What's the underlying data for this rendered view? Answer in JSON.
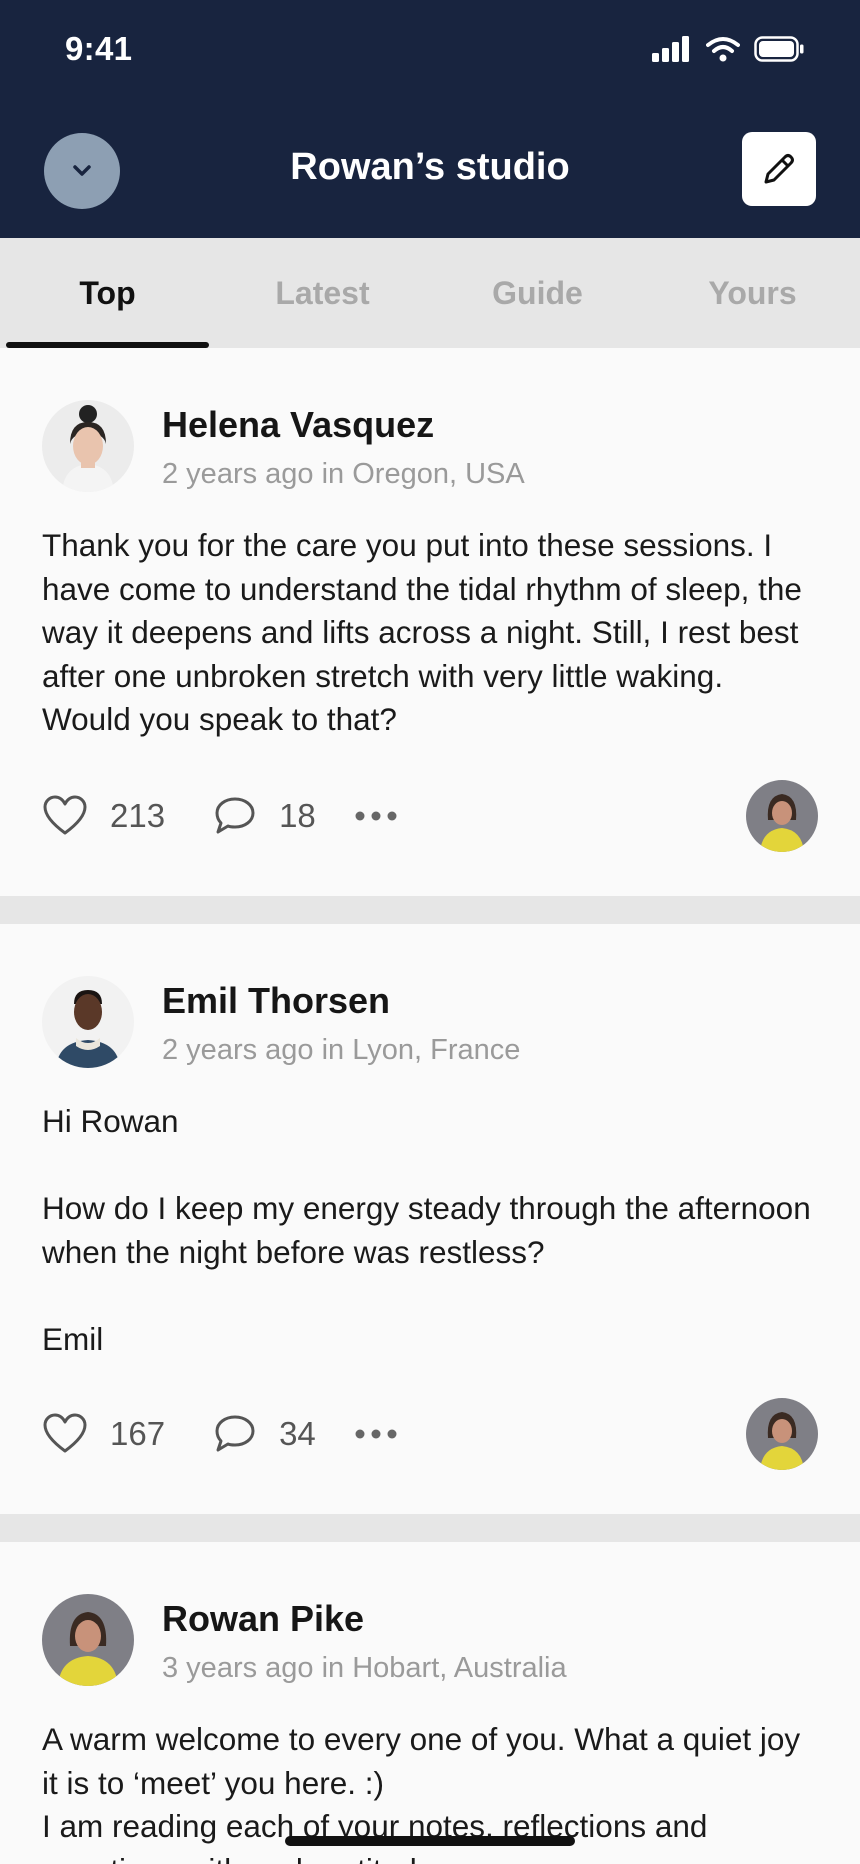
{
  "status_bar": {
    "time": "9:41"
  },
  "header": {
    "title": "Rowan’s studio"
  },
  "tabs": [
    {
      "label": "Top",
      "active": true
    },
    {
      "label": "Latest",
      "active": false
    },
    {
      "label": "Guide",
      "active": false
    },
    {
      "label": "Yours",
      "active": false
    }
  ],
  "posts": [
    {
      "author": "Helena Vasquez",
      "meta": "2 years ago in Oregon, USA",
      "body": "Thank you for the care you put into these sessions. I have come to understand the tidal rhythm of sleep, the way it deepens and lifts across a night. Still, I rest best after one unbroken stretch with very little waking. Would you speak to that?",
      "likes": "213",
      "comments": "18"
    },
    {
      "author": "Emil Thorsen",
      "meta": "2 years ago in Lyon, France",
      "body": "Hi Rowan\n\nHow do I keep my energy steady through the afternoon when the night before was restless?\n\nEmil",
      "likes": "167",
      "comments": "34"
    },
    {
      "author": "Rowan Pike",
      "meta": "3 years ago in Hobart, Australia",
      "body": "A warm welcome to every one of you. What a quiet joy it is to ‘meet’ you here. :)\nI am reading each of your notes, reflections and questions with real gratitude."
    }
  ],
  "colors": {
    "header_bg": "#18243f",
    "tab_bar_bg": "#e6e6e6",
    "collapse_button": "#8d9fb3"
  }
}
